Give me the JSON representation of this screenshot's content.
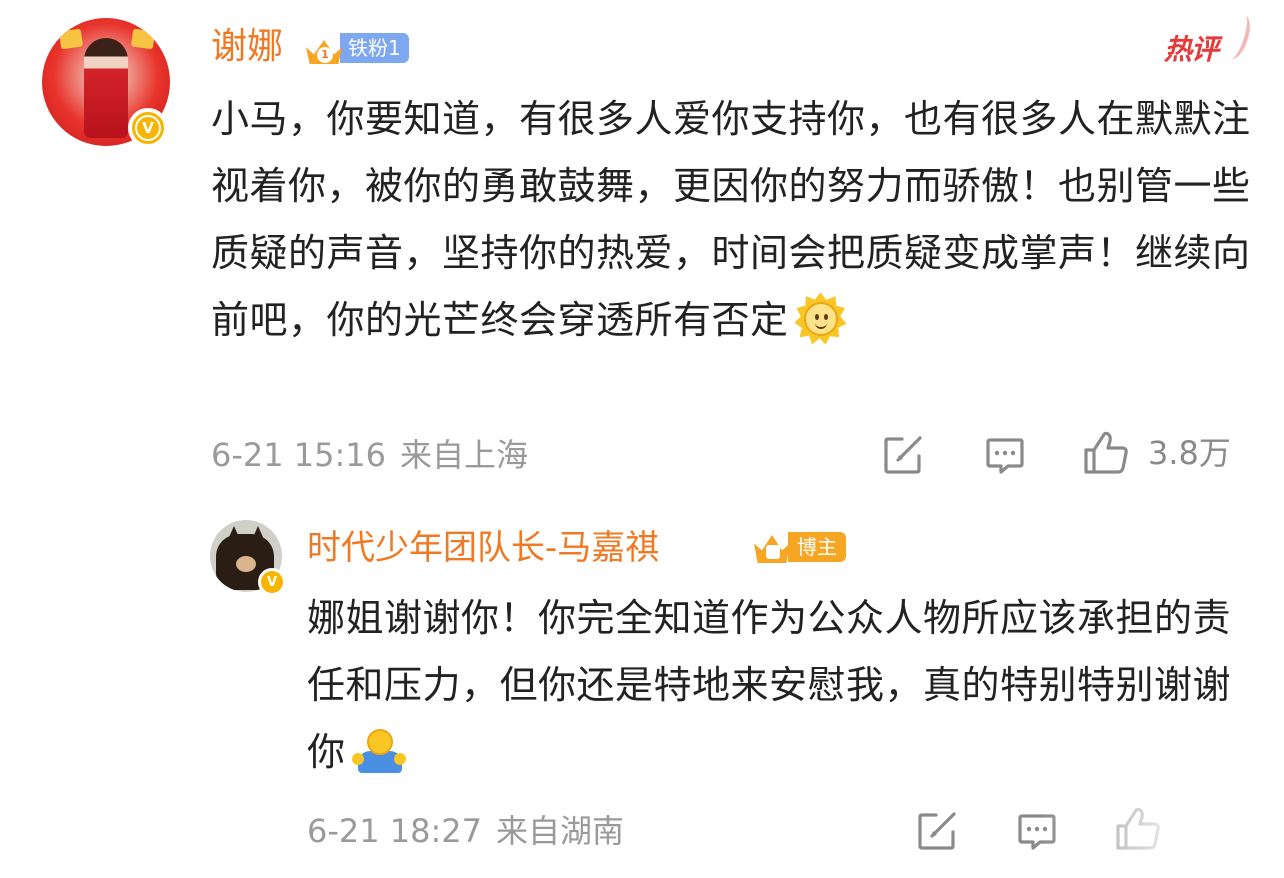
{
  "main_comment": {
    "username": "谢娜",
    "fan_badge": {
      "level": "1",
      "label": "铁粉1"
    },
    "hot_tag": "热评",
    "text": "小马，你要知道，有很多人爱你支持你，也有很多人在默默注视着你，被你的勇敢鼓舞，更因你的努力而骄傲！也别管一些质疑的声音，坚持你的热爱，时间会把质疑变成掌声！继续向前吧，你的光芒终会穿透所有否定",
    "emoji": "sun-smile-emoji",
    "date": "6-21 15:16",
    "location": "来自上海",
    "like_count": "3.8万",
    "verified": "V"
  },
  "reply": {
    "username": "时代少年团队长-马嘉祺",
    "author_badge": "博主",
    "text": "娜姐谢谢你！你完全知道作为公众人物所应该承担的责任和压力，但你还是特地来安慰我，真的特别特别谢谢你",
    "emoji": "hug-emoji",
    "date": "6-21 18:27",
    "location": "来自湖南",
    "verified": "V"
  },
  "icons": {
    "share": "share-icon",
    "comment": "comment-icon",
    "like": "thumbs-up-icon"
  },
  "colors": {
    "username": "#f07a24",
    "fan_badge_bg": "#7da7f0",
    "author_badge_bg": "#f6a623",
    "hot_tag": "#e63a3a",
    "text": "#222222",
    "meta": "#9a9a9a",
    "verified": "#f7b500"
  }
}
